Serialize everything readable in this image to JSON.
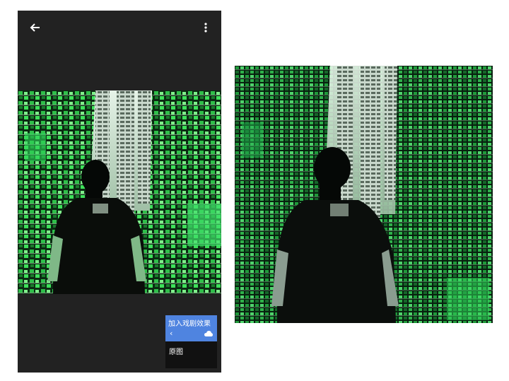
{
  "editor": {
    "back_icon": "arrow-left-icon",
    "menu_icon": "more-vert-icon",
    "popup": {
      "title": "加入戏剧效果",
      "back_icon": "chevron-left-icon",
      "cloud_icon": "cloud-icon",
      "item": "原图"
    }
  },
  "colors": {
    "panel": "#222222",
    "accent": "#4f84e0",
    "popup_body": "#111111"
  }
}
